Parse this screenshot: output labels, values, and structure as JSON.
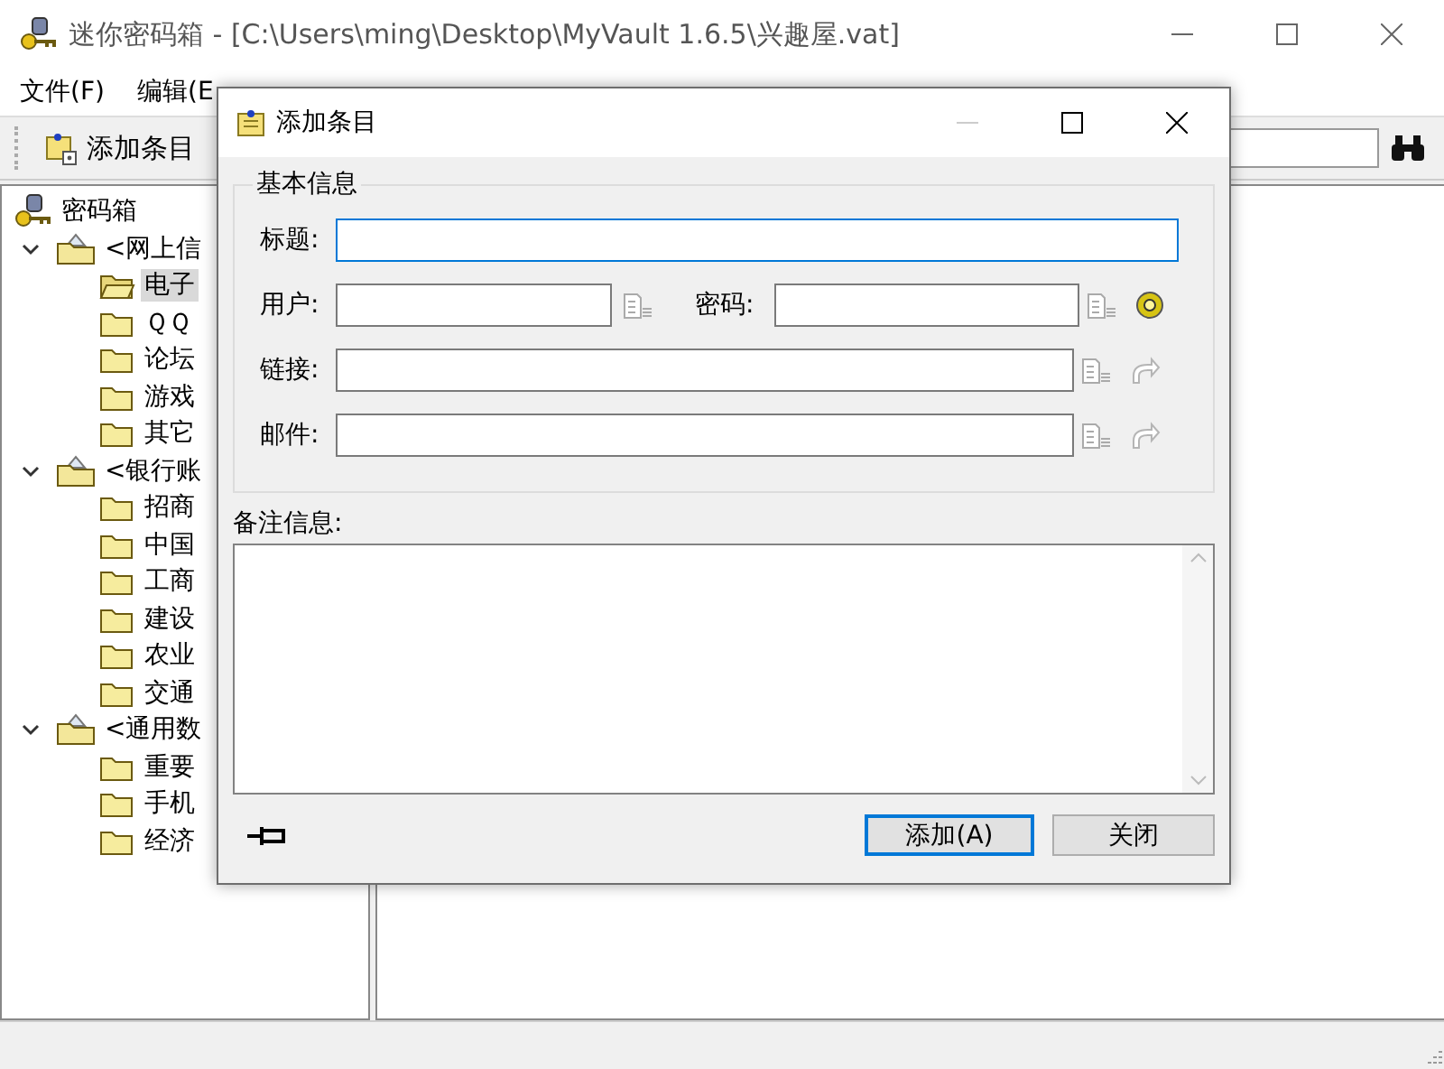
{
  "window": {
    "title": "迷你密码箱 - [C:\\Users\\ming\\Desktop\\MyVault 1.6.5\\兴趣屋.vat]"
  },
  "menu": [
    {
      "label": "文件(F)"
    },
    {
      "label": "编辑(E"
    }
  ],
  "toolbar": {
    "buttons": [
      {
        "label": "添加条目"
      }
    ]
  },
  "tree": {
    "label": "密码箱",
    "children": [
      {
        "label": "<网上信",
        "expanded": true,
        "children": [
          {
            "label": "电子",
            "selected": true
          },
          {
            "label": "ＱＱ",
            "selected": false
          },
          {
            "label": "论坛",
            "selected": false
          },
          {
            "label": "游戏",
            "selected": false
          },
          {
            "label": "其它",
            "selected": false
          }
        ]
      },
      {
        "label": "<银行账",
        "expanded": true,
        "children": [
          {
            "label": "招商",
            "selected": false
          },
          {
            "label": "中国",
            "selected": false
          },
          {
            "label": "工商",
            "selected": false
          },
          {
            "label": "建设",
            "selected": false
          },
          {
            "label": "农业",
            "selected": false
          },
          {
            "label": "交通",
            "selected": false
          }
        ]
      },
      {
        "label": "<通用数",
        "expanded": true,
        "children": [
          {
            "label": "重要",
            "selected": false
          },
          {
            "label": "手机",
            "selected": false
          },
          {
            "label": "经济",
            "selected": false
          }
        ]
      }
    ]
  },
  "dialog": {
    "title": "添加条目",
    "group_title": "基本信息",
    "rows": [
      [
        {
          "kind": "title",
          "label": "标题:",
          "focused": true
        }
      ],
      [
        {
          "kind": "user",
          "label": "用户:",
          "focused": false
        },
        {
          "kind": "password",
          "label": "密码:",
          "focused": false
        }
      ],
      [
        {
          "kind": "link",
          "label": "链接:",
          "focused": false
        }
      ],
      [
        {
          "kind": "mail",
          "label": "邮件:",
          "focused": false
        }
      ]
    ],
    "notes_label": "备注信息:",
    "buttons": [
      {
        "label": "添加(A)",
        "default": true
      },
      {
        "label": "关闭",
        "default": false
      }
    ]
  }
}
